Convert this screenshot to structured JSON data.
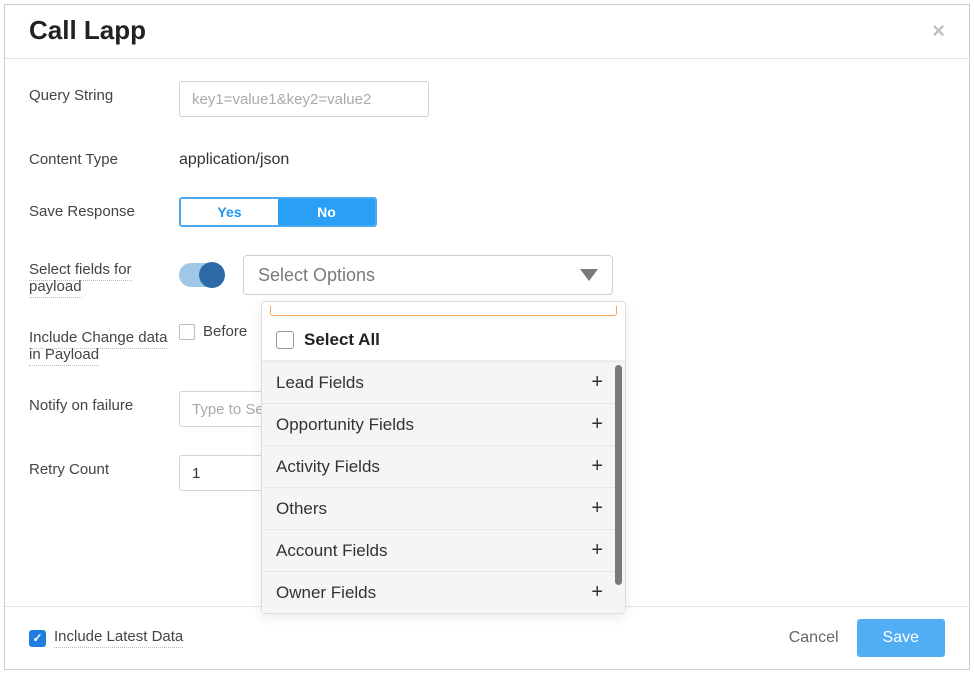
{
  "dialog": {
    "title": "Call Lapp",
    "close_icon": "×"
  },
  "fields": {
    "query_string": {
      "label": "Query String",
      "placeholder": "key1=value1&key2=value2",
      "value": ""
    },
    "content_type": {
      "label": "Content Type",
      "value": "application/json"
    },
    "save_response": {
      "label": "Save Response",
      "options": {
        "yes": "Yes",
        "no": "No"
      },
      "selected": "no"
    },
    "select_payload": {
      "label": "Select fields for payload",
      "placeholder": "Select Options",
      "toggle_on": true
    },
    "include_changes": {
      "label": "Include Change data in Payload",
      "before_label": "Before",
      "before_checked": false
    },
    "notify_failure": {
      "label": "Notify on failure",
      "placeholder": "Type to Se",
      "value": ""
    },
    "retry_count": {
      "label": "Retry Count",
      "value": "1"
    }
  },
  "dropdown": {
    "select_all": "Select All",
    "groups": [
      {
        "label": "Lead Fields"
      },
      {
        "label": "Opportunity Fields"
      },
      {
        "label": "Activity Fields"
      },
      {
        "label": "Others"
      },
      {
        "label": "Account Fields"
      },
      {
        "label": "Owner Fields"
      }
    ],
    "expand_symbol": "+"
  },
  "footer": {
    "include_latest": {
      "label": "Include Latest Data",
      "checked": true
    },
    "cancel": "Cancel",
    "save": "Save"
  }
}
